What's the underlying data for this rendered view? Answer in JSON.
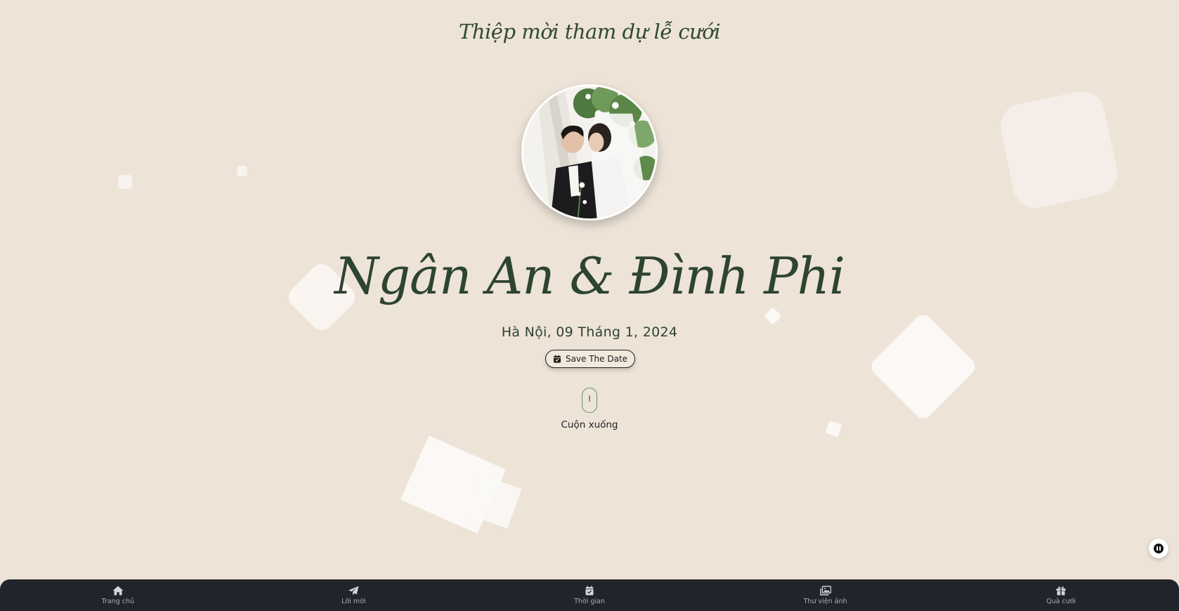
{
  "header": {
    "subtitle": "Thiệp mời tham dự lễ cưới"
  },
  "couple": {
    "names": "Ngân An & Đình Phi"
  },
  "event": {
    "date": "Hà Nội, 09 Tháng 1, 2024"
  },
  "actions": {
    "save_the_date_label": "Save The Date",
    "scroll_label": "Cuộn xuống"
  },
  "colors": {
    "background": "#ede3d7",
    "accent_green": "#2d4430",
    "nav_background": "#21252b",
    "nav_text": "#a9acb1"
  },
  "nav": {
    "items": [
      {
        "label": "Trang chủ",
        "icon": "home-icon"
      },
      {
        "label": "Lời mời",
        "icon": "paper-plane-icon"
      },
      {
        "label": "Thời gian",
        "icon": "calendar-check-icon"
      },
      {
        "label": "Thư viện ảnh",
        "icon": "images-icon"
      },
      {
        "label": "Quà cưới",
        "icon": "gift-icon"
      }
    ]
  }
}
